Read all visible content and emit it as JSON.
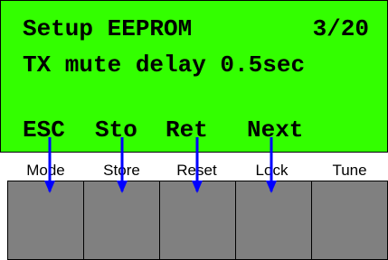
{
  "display": {
    "line1": "Setup EEPROM",
    "page_indicator": "3/20",
    "line2": "TX mute delay 0.5sec",
    "softkeys": [
      "ESC",
      "Sto",
      "Ret",
      "Next"
    ]
  },
  "buttons": [
    {
      "label": "Mode"
    },
    {
      "label": "Store"
    },
    {
      "label": "Reset"
    },
    {
      "label": "Lock"
    },
    {
      "label": "Tune"
    }
  ],
  "colors": {
    "lcd_background": "#33ff00",
    "button_face": "#808080",
    "arrow": "#0000ff"
  }
}
